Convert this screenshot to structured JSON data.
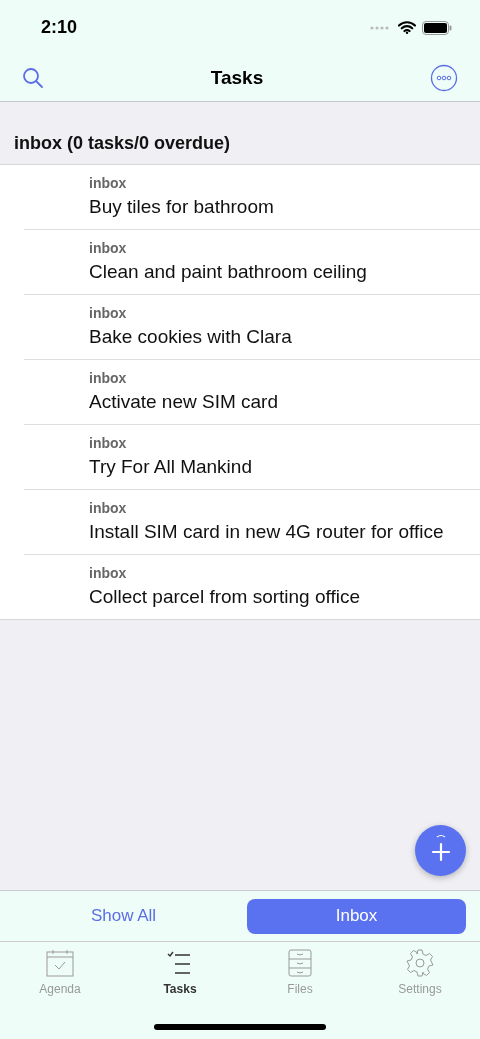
{
  "status_bar": {
    "time": "2:10"
  },
  "nav": {
    "title": "Tasks"
  },
  "section": {
    "title": "inbox (0 tasks/0 overdue)"
  },
  "tasks": [
    {
      "list": "inbox",
      "title": "Buy tiles for bathroom"
    },
    {
      "list": "inbox",
      "title": "Clean and paint bathroom ceiling"
    },
    {
      "list": "inbox",
      "title": "Bake cookies with Clara"
    },
    {
      "list": "inbox",
      "title": "Activate new SIM card"
    },
    {
      "list": "inbox",
      "title": "Try For All Mankind"
    },
    {
      "list": "inbox",
      "title": "Install SIM card in new 4G router for office"
    },
    {
      "list": "inbox",
      "title": "Collect parcel from sorting office"
    }
  ],
  "filter": [
    {
      "label": "Show All",
      "selected": false
    },
    {
      "label": "Inbox",
      "selected": true
    }
  ],
  "tabs": [
    {
      "kind": "agenda",
      "label": "Agenda",
      "selected": false
    },
    {
      "kind": "tasks",
      "label": "Tasks",
      "selected": true
    },
    {
      "kind": "files",
      "label": "Files",
      "selected": false
    },
    {
      "kind": "settings",
      "label": "Settings",
      "selected": false
    }
  ]
}
